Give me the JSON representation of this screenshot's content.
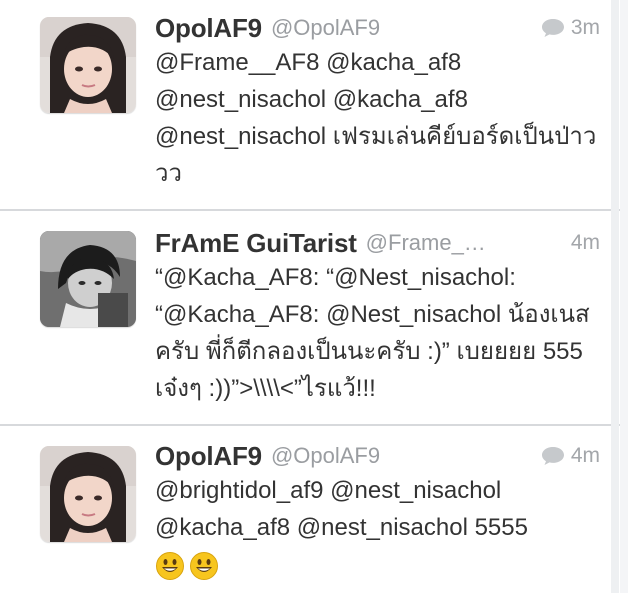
{
  "tweets": [
    {
      "display_name": "OpolAF9",
      "handle": "@OpolAF9",
      "time": "3m",
      "show_reply_icon": true,
      "text": "@Frame__AF8 @kacha_af8 @nest_nisachol @kacha_af8 @nest_nisachol เฟรมเล่นคีย์บอร์ดเป็นป่าววว",
      "avatar": "girl-avatar"
    },
    {
      "display_name": "FrAmE GuiTarist",
      "handle": "@Frame_…",
      "time": "4m",
      "show_reply_icon": false,
      "text": "“@Kacha_AF8: “@Nest_nisachol: “@Kacha_AF8: @Nest_nisachol น้องเนสครับ พี่ก็ตีกลองเป็นนะครับ :)” เบยยยย 555 เจ๋งๆ :))”>\\\\\\\\<”ไรแว้!!!",
      "avatar": "boy-avatar"
    },
    {
      "display_name": "OpolAF9",
      "handle": "@OpolAF9",
      "time": "4m",
      "show_reply_icon": true,
      "text": "@brightidol_af9 @nest_nisachol @kacha_af8 @nest_nisachol 5555",
      "emoji": [
        "smiley-emoji",
        "smiley-emoji"
      ],
      "avatar": "girl-avatar"
    }
  ],
  "colors": {
    "name": "#333333",
    "handle": "#9a9da1",
    "body": "#333333",
    "divider": "#d7d9dc",
    "emoji": "#f7c51e"
  }
}
